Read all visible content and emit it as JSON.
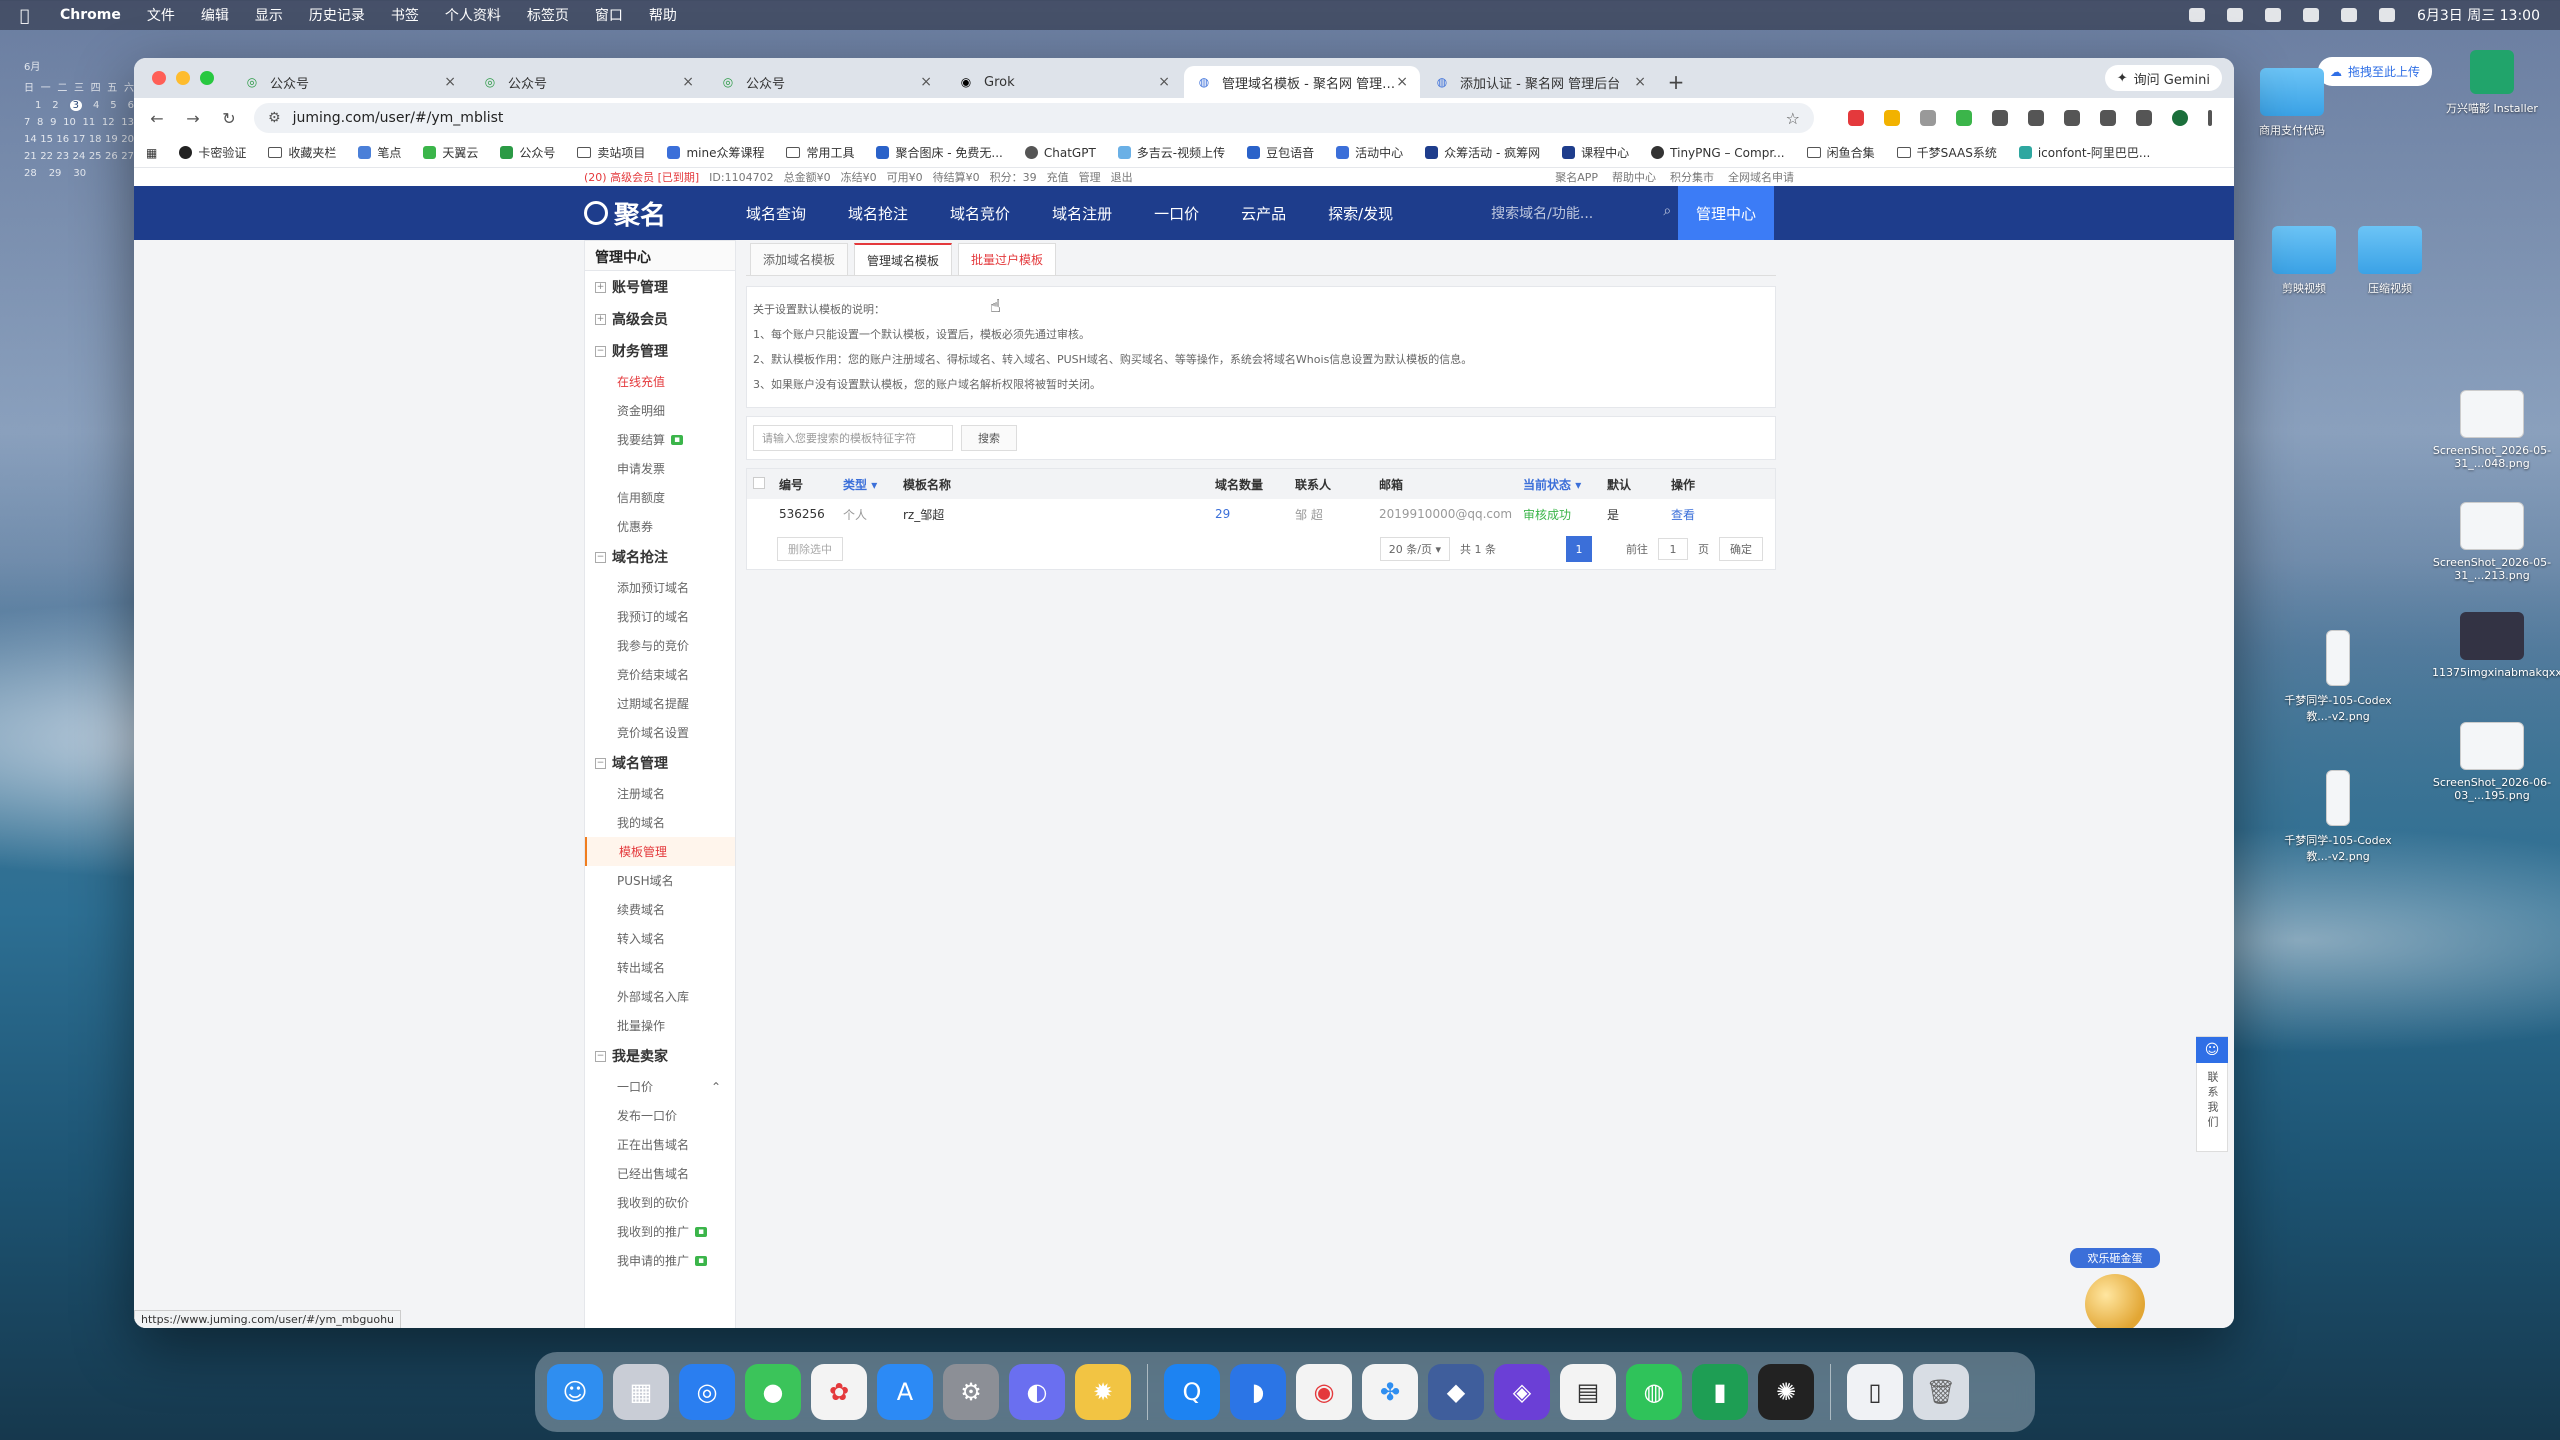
{
  "menubar": {
    "app": "Chrome",
    "items": [
      "文件",
      "编辑",
      "显示",
      "历史记录",
      "书签",
      "个人资料",
      "标签页",
      "窗口",
      "帮助"
    ],
    "datetime": "6月3日 周三  13:00"
  },
  "calendar": {
    "header": "6月",
    "weekdays": [
      "日",
      "一",
      "二",
      "三",
      "四",
      "五",
      "六"
    ],
    "rows": [
      [
        "",
        "1",
        "2",
        "3",
        "4",
        "5",
        "6"
      ],
      [
        "7",
        "8",
        "9",
        "10",
        "11",
        "12",
        "13"
      ],
      [
        "14",
        "15",
        "16",
        "17",
        "18",
        "19",
        "20"
      ],
      [
        "21",
        "22",
        "23",
        "24",
        "25",
        "26",
        "27"
      ],
      [
        "28",
        "29",
        "30",
        "",
        "",
        "",
        ""
      ]
    ]
  },
  "browser": {
    "tabs": [
      {
        "label": "公众号"
      },
      {
        "label": "公众号"
      },
      {
        "label": "公众号"
      },
      {
        "label": "Grok"
      },
      {
        "label": "管理域名模板 - 聚名网 管理后台"
      },
      {
        "label": "添加认证 - 聚名网 管理后台"
      }
    ],
    "gemini": "询问 Gemini",
    "url": "juming.com/user/#/ym_mblist",
    "bookmarks": [
      "卡密验证",
      "收藏夹栏",
      "笔点",
      "天翼云",
      "公众号",
      "卖站项目",
      "mine众筹课程",
      "常用工具",
      "聚合图床 - 免费无...",
      "ChatGPT",
      "多吉云-视频上传",
      "豆包语音",
      "活动中心",
      "众筹活动 - 疯筹网",
      "课程中心",
      "TinyPNG – Compr...",
      "闲鱼合集",
      "千梦SAAS系统",
      "iconfont-阿里巴巴..."
    ],
    "status_url": "https://www.juming.com/user/#/ym_mbguohu"
  },
  "site": {
    "infobar": {
      "level": "(20) 高级会员 [已到期]",
      "id": "ID:1104702",
      "balance": "总金额¥0",
      "frozen": "冻结¥0",
      "available": "可用¥0",
      "pending": "待结算¥0",
      "points": "积分：39",
      "links": [
        "充值",
        "管理",
        "退出"
      ],
      "right_links": [
        "聚名APP",
        "帮助中心",
        "积分集市",
        "全网域名申请"
      ]
    },
    "logo": "聚名",
    "nav": [
      "域名查询",
      "域名抢注",
      "域名竞价",
      "域名注册",
      "一口价",
      "云产品",
      "探索/发现"
    ],
    "search_placeholder": "搜索域名/功能...",
    "manage_center": "管理中心"
  },
  "sidebar": {
    "title": "管理中心",
    "groups": [
      {
        "label": "账号管理",
        "items": []
      },
      {
        "label": "高级会员",
        "items": []
      },
      {
        "label": "财务管理",
        "items": [
          "在线充值",
          "资金明细",
          "我要结算",
          "申请发票",
          "信用额度",
          "优惠券"
        ]
      },
      {
        "label": "域名抢注",
        "items": [
          "添加预订域名",
          "我预订的域名",
          "我参与的竞价",
          "竞价结束域名",
          "过期域名提醒",
          "竞价域名设置"
        ]
      },
      {
        "label": "域名管理",
        "items": [
          "注册域名",
          "我的域名",
          "模板管理",
          "PUSH域名",
          "续费域名",
          "转入域名",
          "转出域名",
          "外部域名入库",
          "批量操作"
        ]
      },
      {
        "label": "我是卖家",
        "items": [
          "一口价",
          "发布一口价",
          "正在出售域名",
          "已经出售域名",
          "我收到的砍价",
          "我收到的推广",
          "我申请的推广"
        ]
      }
    ]
  },
  "panel": {
    "tabs": [
      "添加域名模板",
      "管理域名模板",
      "批量过户模板"
    ],
    "notes_title": "关于设置默认模板的说明：",
    "notes": [
      "1、每个账户只能设置一个默认模板，设置后，模板必须先通过审核。",
      "2、默认模板作用：您的账户注册域名、得标域名、转入域名、PUSH域名、购买域名、等等操作，系统会将域名Whois信息设置为默认模板的信息。",
      "3、如果账户没有设置默认模板，您的账户域名解析权限将被暂时关闭。"
    ],
    "search_placeholder": "请输入您要搜索的模板特征字符",
    "search_btn": "搜索",
    "columns": [
      "编号",
      "类型",
      "模板名称",
      "域名数量",
      "联系人",
      "邮箱",
      "当前状态",
      "默认",
      "操作"
    ],
    "rows": [
      {
        "id": "536256",
        "type": "个人",
        "name": "rz_邹超",
        "count": "29",
        "contact": "邹 超",
        "email": "2019910000@qq.com",
        "status": "审核成功",
        "default": "是",
        "op": "查看"
      }
    ],
    "delete_btn": "删除选中",
    "per_page": "20 条/页",
    "total": "共 1 条",
    "page": "1",
    "goto_label": "前往",
    "goto_value": "1",
    "page_unit": "页",
    "ok_btn": "确定"
  },
  "floating": {
    "contact": "联系我们",
    "promo": "欢乐砸金蛋",
    "close": "×"
  },
  "desktop": {
    "upload": "拖拽至此上传",
    "items": [
      {
        "label": "商用支付代码"
      },
      {
        "label": "剪映视频"
      },
      {
        "label": "压缩视频"
      },
      {
        "label": "万兴喵影 Installer"
      },
      {
        "label": "ScreenShot_2026-05-31_...048.png"
      },
      {
        "label": "ScreenShot_2026-05-31_...213.png"
      },
      {
        "label": "11375imgxinabmakqxx...6p7n.png"
      },
      {
        "label": "千梦同学-105-Codex教...-v2.png"
      },
      {
        "label": "ScreenShot_2026-06-03_...195.png"
      },
      {
        "label": "千梦同学-105-Codex教...-v2.png"
      }
    ]
  }
}
